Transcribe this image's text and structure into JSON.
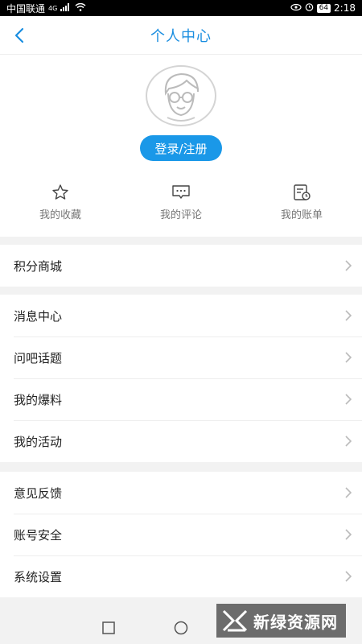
{
  "status_bar": {
    "carrier": "中国联通",
    "network": "4G",
    "battery": "64",
    "time": "2:18"
  },
  "header": {
    "title": "个人中心",
    "back_icon": "chevron-left-icon"
  },
  "profile": {
    "avatar_icon": "default-avatar-icon",
    "login_label": "登录/注册"
  },
  "quick_links": [
    {
      "label": "我的收藏",
      "icon": "star-icon"
    },
    {
      "label": "我的评论",
      "icon": "comment-icon"
    },
    {
      "label": "我的账单",
      "icon": "bill-icon"
    }
  ],
  "menu_groups": [
    {
      "items": [
        {
          "label": "积分商城"
        }
      ]
    },
    {
      "items": [
        {
          "label": "消息中心"
        },
        {
          "label": "问吧话题"
        },
        {
          "label": "我的爆料"
        },
        {
          "label": "我的活动"
        }
      ]
    },
    {
      "items": [
        {
          "label": "意见反馈"
        },
        {
          "label": "账号安全"
        },
        {
          "label": "系统设置"
        }
      ]
    }
  ],
  "watermark": {
    "text": "新绿资源网"
  },
  "colors": {
    "accent": "#1a98e8",
    "title": "#1a8ee0"
  }
}
